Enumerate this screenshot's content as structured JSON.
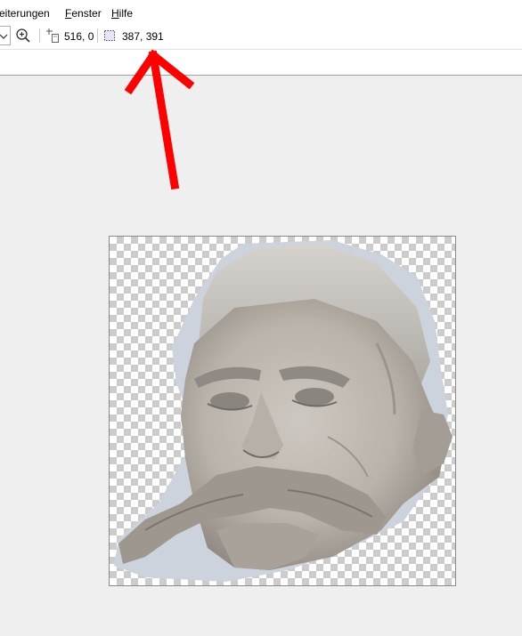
{
  "menubar": {
    "items": [
      {
        "label": "eiterungen",
        "underline": "",
        "rest": "eiterungen"
      },
      {
        "label": "Fenster",
        "underline": "F",
        "rest": "enster"
      },
      {
        "label": "Hilfe",
        "underline": "H",
        "rest": "ilfe"
      }
    ]
  },
  "toolbar": {
    "cursor_position": "516, 0",
    "selection_size": "387, 391",
    "icons": [
      "chevron-down-icon",
      "zoom-in-icon",
      "cursor-position-icon",
      "selection-size-icon"
    ]
  },
  "annotation": {
    "arrow_color": "#ff0000"
  },
  "colors": {
    "menubar_bg": "#ffffff",
    "canvas_bg": "#efefef",
    "checker_dark": "#cccccc",
    "checker_light": "#ffffff"
  }
}
